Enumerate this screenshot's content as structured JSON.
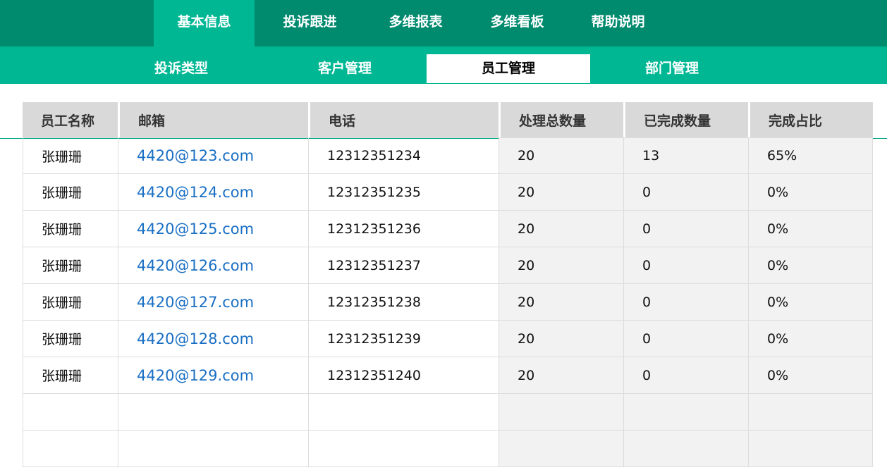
{
  "top_nav": {
    "tabs": [
      {
        "label": "基本信息",
        "active": true
      },
      {
        "label": "投诉跟进",
        "active": false
      },
      {
        "label": "多维报表",
        "active": false
      },
      {
        "label": "多维看板",
        "active": false
      },
      {
        "label": "帮助说明",
        "active": false
      }
    ]
  },
  "sub_nav": {
    "tabs": [
      {
        "label": "投诉类型",
        "active": false
      },
      {
        "label": "客户管理",
        "active": false
      },
      {
        "label": "员工管理",
        "active": true
      },
      {
        "label": "部门管理",
        "active": false
      }
    ]
  },
  "table": {
    "columns": [
      "员工名称",
      "邮箱",
      "电话",
      "处理总数量",
      "已完成数量",
      "完成占比"
    ],
    "rows": [
      [
        "张珊珊",
        "4420@123.com",
        "12312351234",
        "20",
        "13",
        "65%"
      ],
      [
        "张珊珊",
        "4420@124.com",
        "12312351235",
        "20",
        "0",
        "0%"
      ],
      [
        "张珊珊",
        "4420@125.com",
        "12312351236",
        "20",
        "0",
        "0%"
      ],
      [
        "张珊珊",
        "4420@126.com",
        "12312351237",
        "20",
        "0",
        "0%"
      ],
      [
        "张珊珊",
        "4420@127.com",
        "12312351238",
        "20",
        "0",
        "0%"
      ],
      [
        "张珊珊",
        "4420@128.com",
        "12312351239",
        "20",
        "0",
        "0%"
      ],
      [
        "张珊珊",
        "4420@129.com",
        "12312351240",
        "20",
        "0",
        "0%"
      ]
    ],
    "empty_rows": 2
  },
  "colors": {
    "top_nav_bg": "#008a6e",
    "accent": "#00b794",
    "link": "#1a6fc4",
    "header_bg": "#d9d9d9",
    "shaded_cell": "#f2f2f2"
  }
}
